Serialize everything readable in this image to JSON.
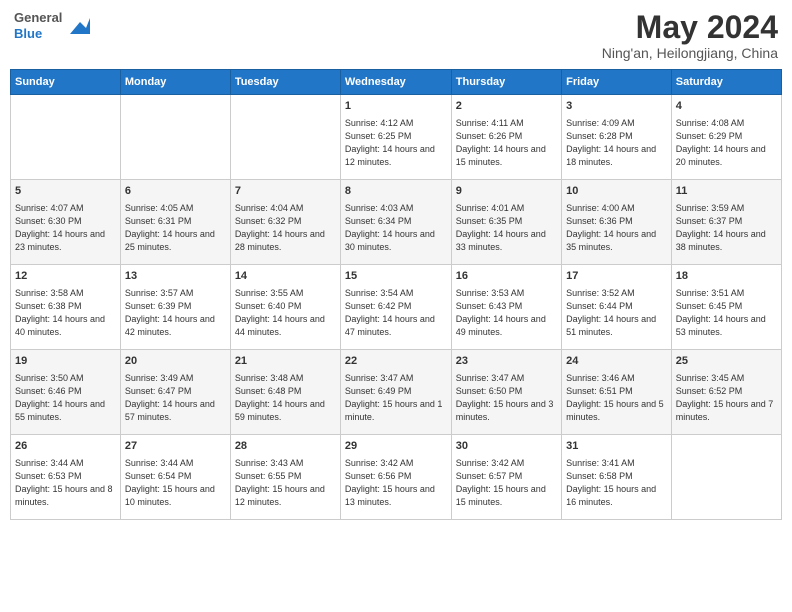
{
  "header": {
    "logo_general": "General",
    "logo_blue": "Blue",
    "month_year": "May 2024",
    "location": "Ning'an, Heilongjiang, China"
  },
  "days_of_week": [
    "Sunday",
    "Monday",
    "Tuesday",
    "Wednesday",
    "Thursday",
    "Friday",
    "Saturday"
  ],
  "weeks": [
    [
      {
        "day": "",
        "sunrise": "",
        "sunset": "",
        "daylight": ""
      },
      {
        "day": "",
        "sunrise": "",
        "sunset": "",
        "daylight": ""
      },
      {
        "day": "",
        "sunrise": "",
        "sunset": "",
        "daylight": ""
      },
      {
        "day": "1",
        "sunrise": "Sunrise: 4:12 AM",
        "sunset": "Sunset: 6:25 PM",
        "daylight": "Daylight: 14 hours and 12 minutes."
      },
      {
        "day": "2",
        "sunrise": "Sunrise: 4:11 AM",
        "sunset": "Sunset: 6:26 PM",
        "daylight": "Daylight: 14 hours and 15 minutes."
      },
      {
        "day": "3",
        "sunrise": "Sunrise: 4:09 AM",
        "sunset": "Sunset: 6:28 PM",
        "daylight": "Daylight: 14 hours and 18 minutes."
      },
      {
        "day": "4",
        "sunrise": "Sunrise: 4:08 AM",
        "sunset": "Sunset: 6:29 PM",
        "daylight": "Daylight: 14 hours and 20 minutes."
      }
    ],
    [
      {
        "day": "5",
        "sunrise": "Sunrise: 4:07 AM",
        "sunset": "Sunset: 6:30 PM",
        "daylight": "Daylight: 14 hours and 23 minutes."
      },
      {
        "day": "6",
        "sunrise": "Sunrise: 4:05 AM",
        "sunset": "Sunset: 6:31 PM",
        "daylight": "Daylight: 14 hours and 25 minutes."
      },
      {
        "day": "7",
        "sunrise": "Sunrise: 4:04 AM",
        "sunset": "Sunset: 6:32 PM",
        "daylight": "Daylight: 14 hours and 28 minutes."
      },
      {
        "day": "8",
        "sunrise": "Sunrise: 4:03 AM",
        "sunset": "Sunset: 6:34 PM",
        "daylight": "Daylight: 14 hours and 30 minutes."
      },
      {
        "day": "9",
        "sunrise": "Sunrise: 4:01 AM",
        "sunset": "Sunset: 6:35 PM",
        "daylight": "Daylight: 14 hours and 33 minutes."
      },
      {
        "day": "10",
        "sunrise": "Sunrise: 4:00 AM",
        "sunset": "Sunset: 6:36 PM",
        "daylight": "Daylight: 14 hours and 35 minutes."
      },
      {
        "day": "11",
        "sunrise": "Sunrise: 3:59 AM",
        "sunset": "Sunset: 6:37 PM",
        "daylight": "Daylight: 14 hours and 38 minutes."
      }
    ],
    [
      {
        "day": "12",
        "sunrise": "Sunrise: 3:58 AM",
        "sunset": "Sunset: 6:38 PM",
        "daylight": "Daylight: 14 hours and 40 minutes."
      },
      {
        "day": "13",
        "sunrise": "Sunrise: 3:57 AM",
        "sunset": "Sunset: 6:39 PM",
        "daylight": "Daylight: 14 hours and 42 minutes."
      },
      {
        "day": "14",
        "sunrise": "Sunrise: 3:55 AM",
        "sunset": "Sunset: 6:40 PM",
        "daylight": "Daylight: 14 hours and 44 minutes."
      },
      {
        "day": "15",
        "sunrise": "Sunrise: 3:54 AM",
        "sunset": "Sunset: 6:42 PM",
        "daylight": "Daylight: 14 hours and 47 minutes."
      },
      {
        "day": "16",
        "sunrise": "Sunrise: 3:53 AM",
        "sunset": "Sunset: 6:43 PM",
        "daylight": "Daylight: 14 hours and 49 minutes."
      },
      {
        "day": "17",
        "sunrise": "Sunrise: 3:52 AM",
        "sunset": "Sunset: 6:44 PM",
        "daylight": "Daylight: 14 hours and 51 minutes."
      },
      {
        "day": "18",
        "sunrise": "Sunrise: 3:51 AM",
        "sunset": "Sunset: 6:45 PM",
        "daylight": "Daylight: 14 hours and 53 minutes."
      }
    ],
    [
      {
        "day": "19",
        "sunrise": "Sunrise: 3:50 AM",
        "sunset": "Sunset: 6:46 PM",
        "daylight": "Daylight: 14 hours and 55 minutes."
      },
      {
        "day": "20",
        "sunrise": "Sunrise: 3:49 AM",
        "sunset": "Sunset: 6:47 PM",
        "daylight": "Daylight: 14 hours and 57 minutes."
      },
      {
        "day": "21",
        "sunrise": "Sunrise: 3:48 AM",
        "sunset": "Sunset: 6:48 PM",
        "daylight": "Daylight: 14 hours and 59 minutes."
      },
      {
        "day": "22",
        "sunrise": "Sunrise: 3:47 AM",
        "sunset": "Sunset: 6:49 PM",
        "daylight": "Daylight: 15 hours and 1 minute."
      },
      {
        "day": "23",
        "sunrise": "Sunrise: 3:47 AM",
        "sunset": "Sunset: 6:50 PM",
        "daylight": "Daylight: 15 hours and 3 minutes."
      },
      {
        "day": "24",
        "sunrise": "Sunrise: 3:46 AM",
        "sunset": "Sunset: 6:51 PM",
        "daylight": "Daylight: 15 hours and 5 minutes."
      },
      {
        "day": "25",
        "sunrise": "Sunrise: 3:45 AM",
        "sunset": "Sunset: 6:52 PM",
        "daylight": "Daylight: 15 hours and 7 minutes."
      }
    ],
    [
      {
        "day": "26",
        "sunrise": "Sunrise: 3:44 AM",
        "sunset": "Sunset: 6:53 PM",
        "daylight": "Daylight: 15 hours and 8 minutes."
      },
      {
        "day": "27",
        "sunrise": "Sunrise: 3:44 AM",
        "sunset": "Sunset: 6:54 PM",
        "daylight": "Daylight: 15 hours and 10 minutes."
      },
      {
        "day": "28",
        "sunrise": "Sunrise: 3:43 AM",
        "sunset": "Sunset: 6:55 PM",
        "daylight": "Daylight: 15 hours and 12 minutes."
      },
      {
        "day": "29",
        "sunrise": "Sunrise: 3:42 AM",
        "sunset": "Sunset: 6:56 PM",
        "daylight": "Daylight: 15 hours and 13 minutes."
      },
      {
        "day": "30",
        "sunrise": "Sunrise: 3:42 AM",
        "sunset": "Sunset: 6:57 PM",
        "daylight": "Daylight: 15 hours and 15 minutes."
      },
      {
        "day": "31",
        "sunrise": "Sunrise: 3:41 AM",
        "sunset": "Sunset: 6:58 PM",
        "daylight": "Daylight: 15 hours and 16 minutes."
      },
      {
        "day": "",
        "sunrise": "",
        "sunset": "",
        "daylight": ""
      }
    ]
  ]
}
